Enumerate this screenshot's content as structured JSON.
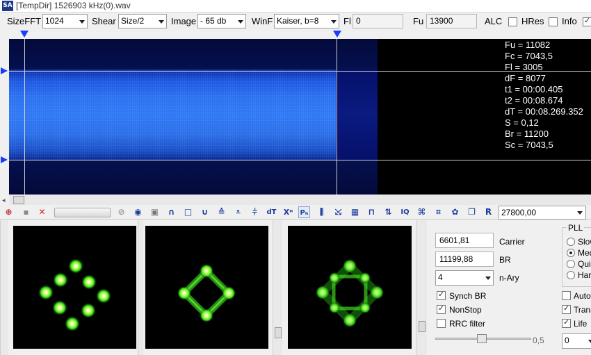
{
  "title": "[TempDir] 1526903 kHz(0).wav",
  "logo_text": "SA",
  "controls": {
    "sizefft_label": "SizeFFT",
    "sizefft_value": "1024",
    "shear_label": "Shear",
    "shear_value": "Size/2",
    "image_label": "Image",
    "image_value": "- 65 db",
    "winf_label": "WinF",
    "winf_value": "Kaiser, b=8",
    "fl_label": "Fl",
    "fl_value": "0",
    "fu_label": "Fu",
    "fu_value": "13900",
    "alc_label": "ALC",
    "alc_checked": false,
    "hres_label": "HRes",
    "hres_checked": false,
    "info_label": "Info",
    "info_checked": true
  },
  "readout": {
    "fu": "Fu = 11082",
    "fc": "Fc = 7043,5",
    "fl": "Fl = 3005",
    "df": "dF = 8077",
    "t1": "t1 = 00:00.405",
    "t2": "t2 = 00:08.674",
    "dt": "dT = 00:08.269.352",
    "s": "S = 0,12",
    "br": "Br = 11200",
    "sc": "Sc = 7043,5"
  },
  "toolbar": {
    "freq_value": "27800,00",
    "scroll_left": "◂"
  },
  "settings": {
    "carrier_value": "6601,81",
    "carrier_label": "Carrier",
    "br_value": "11199,88",
    "br_label": "BR",
    "nary_value": "4",
    "nary_label": "n-Ary",
    "synch_br_label": "Synch BR",
    "synch_br_checked": true,
    "nonstop_label": "NonStop",
    "nonstop_checked": true,
    "rrc_label": "RRC filter",
    "rrc_checked": false,
    "slider_value": "0,5",
    "pll_label": "PLL",
    "pll_options": [
      "Slow",
      "Medium",
      "Quick",
      "Hard"
    ],
    "pll_selected": 1,
    "auto_label": "Auto",
    "auto_checked": false,
    "trans_label": "Trans",
    "trans_checked": true,
    "life_label": "Life",
    "life_checked": true,
    "bottom_value": "0"
  },
  "colors": {
    "marker_blue": "#1a3cff",
    "constellation_green": "#35e01a"
  }
}
